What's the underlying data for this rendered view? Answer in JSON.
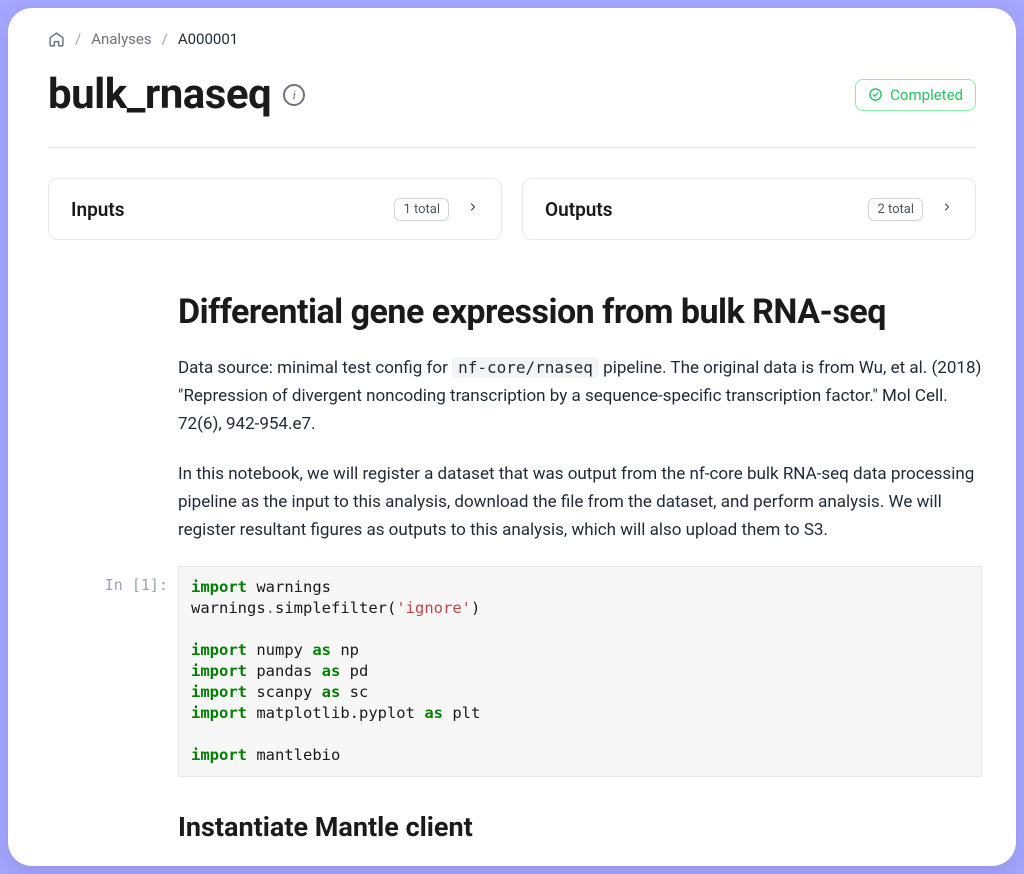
{
  "breadcrumb": {
    "analyses": "Analyses",
    "current": "A000001"
  },
  "title": "bulk_rnaseq",
  "status": {
    "label": "Completed"
  },
  "io": {
    "inputs": {
      "label": "Inputs",
      "count": "1 total"
    },
    "outputs": {
      "label": "Outputs",
      "count": "2 total"
    }
  },
  "notebook": {
    "h1": "Differential gene expression from bulk RNA-seq",
    "p1_a": "Data source: minimal test config for ",
    "p1_code": "nf-core/rnaseq",
    "p1_b": " pipeline. The original data is from Wu, et al. (2018) \"Repression of divergent noncoding transcription by a sequence-specific transcription factor.\" Mol Cell. 72(6), 942-954.e7.",
    "p2": "In this notebook, we will register a dataset that was output from the nf-core bulk RNA-seq data processing pipeline as the input to this analysis, download the file from the dataset, and perform analysis. We will register resultant figures as outputs to this analysis, which will also upload them to S3.",
    "cell1": {
      "prompt": "In [1]:",
      "tokens": {
        "import": "import",
        "as": "as",
        "warnings1": " warnings",
        "warnings2": "warnings",
        "dot": ".",
        "simplefilter": "simplefilter(",
        "ignore": "'ignore'",
        "close": ")",
        "numpy": " numpy ",
        "np": " np",
        "pandas": " pandas ",
        "pd": " pd",
        "scanpy": " scanpy ",
        "sc": " sc",
        "mpl": " matplotlib.pyplot ",
        "plt": " plt",
        "mantlebio": " mantlebio"
      }
    },
    "h2": "Instantiate Mantle client"
  }
}
